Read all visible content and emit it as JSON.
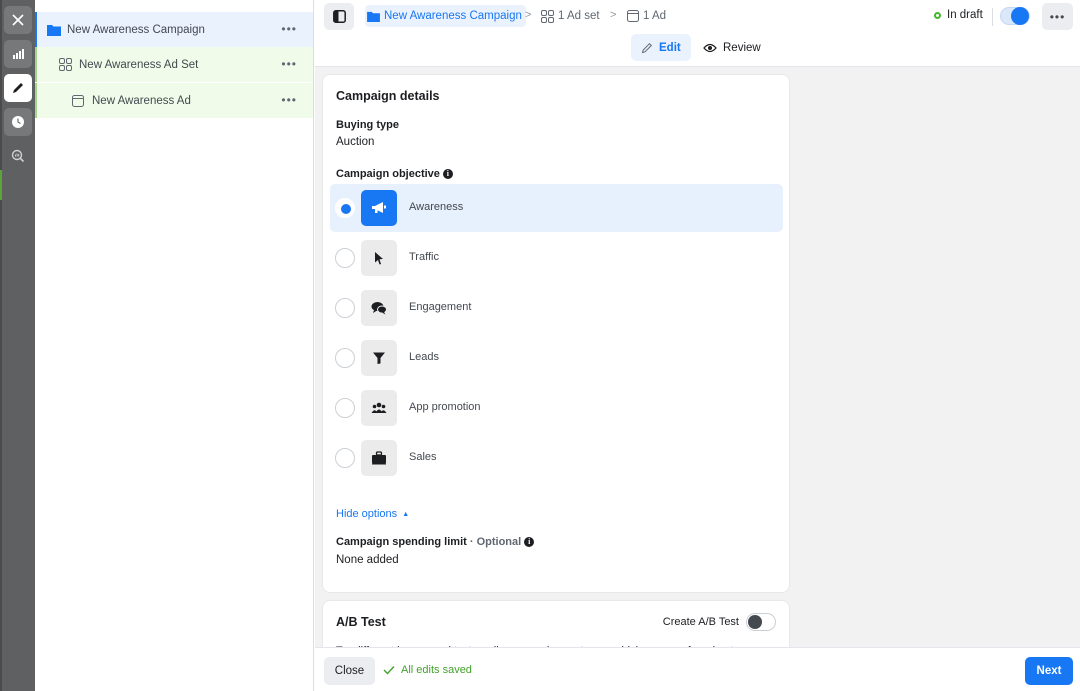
{
  "rail": {
    "items": [
      {
        "name": "close",
        "icon": "close-icon"
      },
      {
        "name": "reporting",
        "icon": "bar-chart-icon"
      },
      {
        "name": "edit",
        "icon": "pencil-icon",
        "active": true
      },
      {
        "name": "history",
        "icon": "clock-icon"
      },
      {
        "name": "analyze",
        "icon": "magnifier-chart-icon"
      }
    ]
  },
  "tree": {
    "campaign": {
      "label": "New Awareness Campaign",
      "icon": "folder-icon",
      "more": "•••"
    },
    "adset": {
      "label": "New Awareness Ad Set",
      "icon": "grid-icon",
      "more": "•••"
    },
    "ad": {
      "label": "New Awareness Ad",
      "icon": "ad-window-icon",
      "more": "•••"
    }
  },
  "header": {
    "breadcrumb": [
      {
        "label": "New Awareness Campaign",
        "icon": "folder-icon"
      },
      {
        "label": "1 Ad set",
        "icon": "grid-icon"
      },
      {
        "label": "1 Ad",
        "icon": "ad-window-icon"
      }
    ],
    "separator": ">",
    "status": "In draft",
    "toggle_on": true,
    "more": "•••"
  },
  "tabs": {
    "edit": "Edit",
    "review": "Review",
    "active": "edit"
  },
  "colors": {
    "accent": "#1877f2",
    "success": "#42b72a",
    "selected_bg": "#e7f0fd"
  },
  "campaign_details": {
    "title": "Campaign details",
    "buying_type_label": "Buying type",
    "buying_type_value": "Auction",
    "objective_label": "Campaign objective",
    "objectives": [
      {
        "label": "Awareness",
        "icon": "megaphone-icon",
        "selected": true
      },
      {
        "label": "Traffic",
        "icon": "cursor-icon",
        "selected": false
      },
      {
        "label": "Engagement",
        "icon": "chat-bubbles-icon",
        "selected": false
      },
      {
        "label": "Leads",
        "icon": "funnel-icon",
        "selected": false
      },
      {
        "label": "App promotion",
        "icon": "people-icon",
        "selected": false
      },
      {
        "label": "Sales",
        "icon": "briefcase-icon",
        "selected": false
      }
    ],
    "hide_options": "Hide options",
    "spending_limit_label": "Campaign spending limit",
    "spending_limit_optional": "· Optional",
    "spending_limit_value": "None added"
  },
  "ab_test": {
    "title": "A/B Test",
    "toggle_label": "Create A/B Test",
    "toggle_on": false,
    "description": "Try different images, ad text, audiences and more to see which ones perform best."
  },
  "footer": {
    "close": "Close",
    "saved": "All edits saved",
    "next": "Next"
  }
}
